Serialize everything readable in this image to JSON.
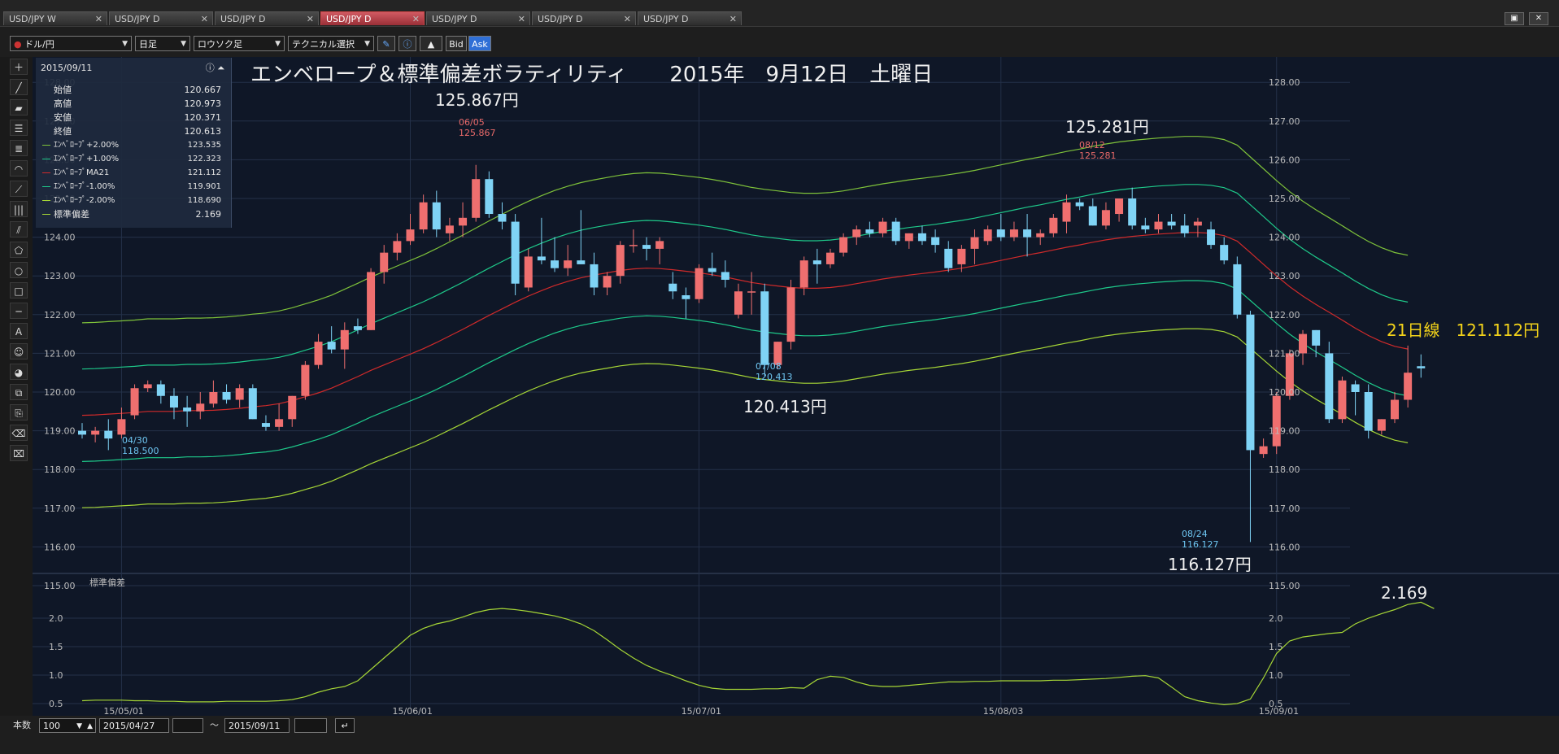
{
  "tabs": [
    {
      "label": "USD/JPY W",
      "active": false
    },
    {
      "label": "USD/JPY D",
      "active": false
    },
    {
      "label": "USD/JPY D",
      "active": false
    },
    {
      "label": "USD/JPY D",
      "active": true
    },
    {
      "label": "USD/JPY D",
      "active": false
    },
    {
      "label": "USD/JPY D",
      "active": false
    },
    {
      "label": "USD/JPY D",
      "active": false
    }
  ],
  "toolbar": {
    "pair": "ドル/円",
    "period": "日足",
    "chart_type": "ロウソク足",
    "technical": "テクニカル選択",
    "bid": "Bid",
    "ask": "Ask"
  },
  "info_panel": {
    "date": "2015/09/11",
    "rows": [
      {
        "label": "始値",
        "value": "120.667"
      },
      {
        "label": "高値",
        "value": "120.973"
      },
      {
        "label": "安値",
        "value": "120.371"
      },
      {
        "label": "終値",
        "value": "120.613"
      }
    ],
    "indicators": [
      {
        "label": "ｴﾝﾍﾞﾛｰﾌﾟ+2.00%",
        "value": "123.535",
        "color": "#7ec23a"
      },
      {
        "label": "ｴﾝﾍﾞﾛｰﾌﾟ+1.00%",
        "value": "122.323",
        "color": "#1ec98a"
      },
      {
        "label": "ｴﾝﾍﾞﾛｰﾌﾟMA21",
        "value": "121.112",
        "color": "#d02a2a"
      },
      {
        "label": "ｴﾝﾍﾞﾛｰﾌﾟ-1.00%",
        "value": "119.901",
        "color": "#1ec98a"
      },
      {
        "label": "ｴﾝﾍﾞﾛｰﾌﾟ-2.00%",
        "value": "118.690",
        "color": "#a6d636"
      },
      {
        "label": "標準偏差",
        "value": "2.169",
        "color": "#a6d636"
      }
    ]
  },
  "annotations": {
    "title": "エンベロープ＆標準偏差ボラティリティ　　2015年　9月12日　土曜日",
    "high1": "125.867円",
    "high2": "125.281円",
    "low1": "120.413円",
    "low2": "116.127円",
    "ma21": "21日線　121.112円",
    "sd": "2.169",
    "mark_0430": "04/30",
    "mark_0430_v": "118.500",
    "mark_0605": "06/05",
    "mark_0605_v": "125.867",
    "mark_0708": "07/08",
    "mark_0708_v": "120.413",
    "mark_0812": "08/12",
    "mark_0812_v": "125.281",
    "mark_0824": "08/24",
    "mark_0824_v": "116.127"
  },
  "sub_panel_label": "標準偏差",
  "bottom": {
    "count_label": "本数",
    "count": "100",
    "from": "2015/04/27",
    "tilde": "〜",
    "to": "2015/09/11"
  },
  "chart_data": {
    "type": "candlestick",
    "title": "エンベロープ＆標準偏差ボラティリティ　　2015年　9月12日　土曜日",
    "ylim": [
      115,
      128
    ],
    "yticks": [
      "115.00",
      "116.00",
      "117.00",
      "118.00",
      "119.00",
      "120.00",
      "121.00",
      "122.00",
      "123.00",
      "124.00",
      "125.00",
      "126.00",
      "127.00",
      "128.00"
    ],
    "sub_ylim": [
      0.4,
      2.4
    ],
    "sub_yticks": [
      "0.5",
      "1.0",
      "1.5",
      "2.0"
    ],
    "xticks": [
      {
        "i": 3,
        "label": "15/05/01"
      },
      {
        "i": 25,
        "label": "15/06/01"
      },
      {
        "i": 47,
        "label": "15/07/01"
      },
      {
        "i": 70,
        "label": "15/08/03"
      },
      {
        "i": 91,
        "label": "15/09/01"
      }
    ],
    "candles": [
      [
        119.0,
        119.2,
        118.8,
        118.9
      ],
      [
        118.9,
        119.1,
        118.7,
        119.0
      ],
      [
        119.0,
        119.3,
        118.5,
        118.8
      ],
      [
        118.9,
        119.6,
        118.8,
        119.3
      ],
      [
        119.4,
        120.2,
        119.3,
        120.1
      ],
      [
        120.1,
        120.3,
        120.0,
        120.2
      ],
      [
        120.2,
        120.3,
        119.7,
        119.9
      ],
      [
        119.9,
        120.1,
        119.3,
        119.6
      ],
      [
        119.6,
        119.9,
        119.1,
        119.5
      ],
      [
        119.5,
        120.0,
        119.3,
        119.7
      ],
      [
        119.7,
        120.3,
        119.6,
        120.0
      ],
      [
        120.0,
        120.2,
        119.7,
        119.8
      ],
      [
        119.8,
        120.2,
        119.6,
        120.1
      ],
      [
        120.1,
        120.2,
        119.3,
        119.3
      ],
      [
        119.2,
        119.4,
        119.0,
        119.1
      ],
      [
        119.1,
        119.7,
        119.0,
        119.3
      ],
      [
        119.3,
        119.9,
        119.1,
        119.9
      ],
      [
        119.9,
        120.8,
        119.8,
        120.7
      ],
      [
        120.7,
        121.5,
        120.6,
        121.3
      ],
      [
        121.3,
        121.7,
        121.0,
        121.1
      ],
      [
        121.1,
        121.8,
        120.6,
        121.6
      ],
      [
        121.7,
        121.9,
        121.5,
        121.6
      ],
      [
        121.6,
        123.2,
        121.6,
        123.1
      ],
      [
        123.1,
        123.8,
        122.8,
        123.6
      ],
      [
        123.6,
        124.1,
        123.4,
        123.9
      ],
      [
        123.9,
        124.6,
        123.8,
        124.2
      ],
      [
        124.2,
        125.1,
        124.1,
        124.9
      ],
      [
        124.9,
        125.2,
        124.0,
        124.2
      ],
      [
        124.1,
        124.5,
        123.9,
        124.3
      ],
      [
        124.3,
        124.9,
        124.0,
        124.5
      ],
      [
        124.5,
        125.867,
        124.4,
        125.5
      ],
      [
        125.5,
        125.7,
        124.5,
        124.6
      ],
      [
        124.6,
        124.9,
        124.2,
        124.4
      ],
      [
        124.4,
        124.6,
        122.5,
        122.8
      ],
      [
        122.7,
        123.7,
        122.6,
        123.5
      ],
      [
        123.5,
        124.5,
        123.3,
        123.4
      ],
      [
        123.4,
        124.0,
        123.1,
        123.2
      ],
      [
        123.2,
        123.8,
        123.0,
        123.4
      ],
      [
        123.4,
        124.7,
        123.3,
        123.3
      ],
      [
        123.3,
        123.6,
        122.5,
        122.7
      ],
      [
        122.7,
        123.1,
        122.5,
        123.0
      ],
      [
        123.0,
        123.9,
        122.8,
        123.8
      ],
      [
        123.8,
        124.2,
        123.6,
        123.8
      ],
      [
        123.8,
        124.0,
        123.4,
        123.7
      ],
      [
        123.7,
        124.0,
        123.3,
        123.9
      ],
      [
        122.8,
        123.1,
        122.4,
        122.6
      ],
      [
        122.5,
        122.7,
        121.9,
        122.4
      ],
      [
        122.4,
        123.3,
        122.3,
        123.2
      ],
      [
        123.2,
        123.6,
        123.0,
        123.1
      ],
      [
        123.1,
        123.4,
        122.7,
        122.9
      ],
      [
        122.0,
        122.8,
        121.9,
        122.6
      ],
      [
        122.6,
        123.1,
        122.0,
        122.6
      ],
      [
        122.6,
        122.8,
        120.413,
        120.7
      ],
      [
        120.7,
        121.3,
        120.6,
        121.3
      ],
      [
        121.3,
        122.9,
        121.1,
        122.7
      ],
      [
        122.7,
        123.5,
        122.5,
        123.4
      ],
      [
        123.4,
        123.7,
        122.8,
        123.3
      ],
      [
        123.3,
        123.7,
        123.2,
        123.6
      ],
      [
        123.6,
        124.1,
        123.5,
        124.0
      ],
      [
        124.0,
        124.3,
        123.8,
        124.2
      ],
      [
        124.2,
        124.4,
        124.0,
        124.1
      ],
      [
        124.1,
        124.5,
        124.0,
        124.4
      ],
      [
        124.4,
        124.5,
        123.8,
        123.9
      ],
      [
        123.9,
        124.1,
        123.7,
        124.1
      ],
      [
        124.1,
        124.3,
        123.8,
        123.9
      ],
      [
        124.0,
        124.2,
        123.6,
        123.8
      ],
      [
        123.7,
        123.9,
        123.1,
        123.2
      ],
      [
        123.3,
        123.8,
        123.1,
        123.7
      ],
      [
        123.7,
        124.2,
        123.3,
        124.0
      ],
      [
        123.9,
        124.3,
        123.8,
        124.2
      ],
      [
        124.2,
        124.6,
        123.9,
        124.0
      ],
      [
        124.0,
        124.4,
        123.9,
        124.2
      ],
      [
        124.2,
        124.6,
        123.5,
        124.0
      ],
      [
        124.0,
        124.2,
        123.8,
        124.1
      ],
      [
        124.1,
        124.6,
        124.0,
        124.5
      ],
      [
        124.4,
        125.1,
        124.1,
        124.9
      ],
      [
        124.9,
        125.0,
        124.7,
        124.8
      ],
      [
        124.8,
        125.0,
        124.3,
        124.3
      ],
      [
        124.3,
        124.9,
        124.2,
        124.7
      ],
      [
        124.6,
        125.0,
        124.4,
        125.0
      ],
      [
        125.0,
        125.281,
        124.2,
        124.3
      ],
      [
        124.3,
        124.5,
        124.1,
        124.2
      ],
      [
        124.2,
        124.6,
        124.1,
        124.4
      ],
      [
        124.4,
        124.6,
        124.2,
        124.3
      ],
      [
        124.3,
        124.6,
        124.0,
        124.1
      ],
      [
        124.3,
        124.5,
        124.0,
        124.4
      ],
      [
        124.2,
        124.4,
        123.7,
        123.8
      ],
      [
        123.8,
        124.0,
        123.3,
        123.4
      ],
      [
        123.3,
        123.5,
        121.9,
        122.0
      ],
      [
        122.0,
        122.1,
        116.127,
        118.5
      ],
      [
        118.4,
        118.8,
        118.3,
        118.6
      ],
      [
        118.6,
        120.0,
        118.4,
        119.9
      ],
      [
        119.9,
        121.1,
        119.8,
        121.0
      ],
      [
        121.0,
        121.6,
        120.7,
        121.5
      ],
      [
        121.6,
        121.6,
        120.9,
        121.2
      ],
      [
        121.0,
        121.3,
        119.2,
        119.3
      ],
      [
        119.3,
        120.4,
        119.2,
        120.3
      ],
      [
        120.2,
        120.3,
        119.4,
        120.0
      ],
      [
        120.0,
        120.2,
        118.8,
        119.0
      ],
      [
        119.0,
        119.3,
        118.9,
        119.3
      ],
      [
        119.3,
        120.0,
        119.2,
        119.8
      ],
      [
        119.8,
        121.2,
        119.6,
        120.5
      ],
      [
        120.667,
        120.973,
        120.371,
        120.613
      ]
    ],
    "ma21": [
      119.4,
      119.41,
      119.43,
      119.45,
      119.47,
      119.5,
      119.5,
      119.5,
      119.52,
      119.52,
      119.53,
      119.55,
      119.58,
      119.62,
      119.65,
      119.7,
      119.78,
      119.88,
      119.98,
      120.1,
      120.25,
      120.4,
      120.56,
      120.7,
      120.84,
      120.98,
      121.12,
      121.28,
      121.45,
      121.62,
      121.8,
      121.98,
      122.15,
      122.32,
      122.48,
      122.62,
      122.75,
      122.86,
      122.95,
      123.02,
      123.08,
      123.14,
      123.18,
      123.2,
      123.19,
      123.16,
      123.12,
      123.08,
      123.03,
      122.97,
      122.9,
      122.83,
      122.78,
      122.74,
      122.7,
      122.68,
      122.68,
      122.7,
      122.74,
      122.8,
      122.86,
      122.92,
      122.97,
      123.02,
      123.06,
      123.1,
      123.15,
      123.2,
      123.26,
      123.33,
      123.4,
      123.47,
      123.54,
      123.6,
      123.67,
      123.74,
      123.8,
      123.87,
      123.93,
      123.98,
      124.02,
      124.05,
      124.08,
      124.1,
      124.12,
      124.12,
      124.1,
      124.04,
      123.9,
      123.6,
      123.3,
      123.0,
      122.72,
      122.48,
      122.26,
      122.06,
      121.86,
      121.65,
      121.46,
      121.3,
      121.18,
      121.112
    ],
    "sd": [
      0.55,
      0.56,
      0.56,
      0.56,
      0.55,
      0.55,
      0.54,
      0.54,
      0.53,
      0.53,
      0.53,
      0.54,
      0.54,
      0.54,
      0.54,
      0.55,
      0.57,
      0.62,
      0.7,
      0.76,
      0.8,
      0.9,
      1.1,
      1.3,
      1.5,
      1.7,
      1.82,
      1.9,
      1.95,
      2.02,
      2.1,
      2.15,
      2.17,
      2.15,
      2.12,
      2.08,
      2.04,
      1.98,
      1.9,
      1.78,
      1.62,
      1.45,
      1.3,
      1.17,
      1.07,
      0.99,
      0.9,
      0.82,
      0.77,
      0.75,
      0.75,
      0.75,
      0.76,
      0.76,
      0.78,
      0.77,
      0.92,
      0.98,
      0.96,
      0.88,
      0.82,
      0.8,
      0.8,
      0.82,
      0.84,
      0.86,
      0.88,
      0.88,
      0.89,
      0.89,
      0.9,
      0.9,
      0.9,
      0.9,
      0.91,
      0.91,
      0.92,
      0.93,
      0.94,
      0.96,
      0.98,
      0.99,
      0.95,
      0.79,
      0.62,
      0.55,
      0.51,
      0.48,
      0.5,
      0.58,
      0.95,
      1.38,
      1.6,
      1.67,
      1.7,
      1.73,
      1.75,
      1.9,
      2.0,
      2.08,
      2.15,
      2.24,
      2.28,
      2.169
    ]
  }
}
